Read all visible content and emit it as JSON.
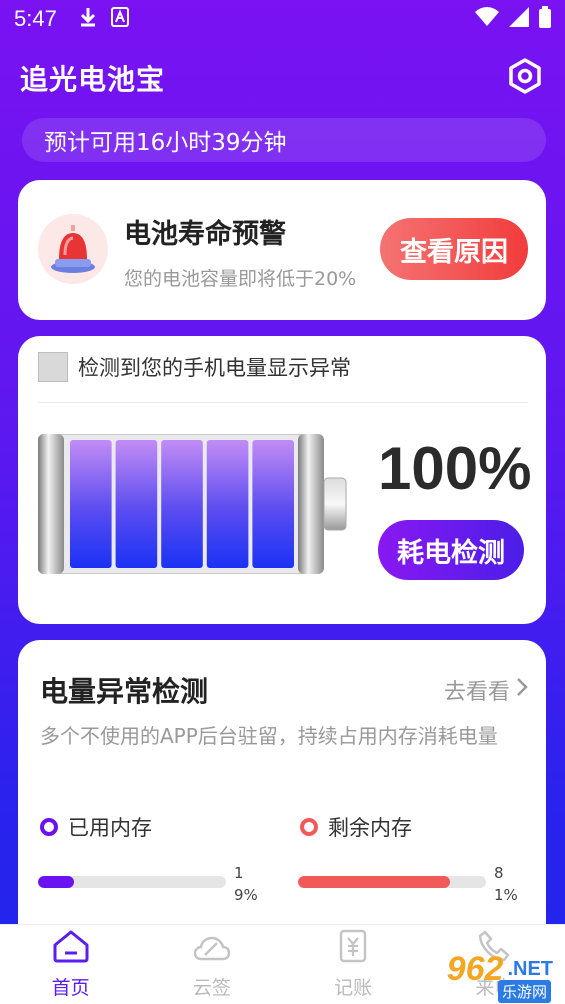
{
  "status_bar": {
    "time": "5:47",
    "icons": [
      "download-icon",
      "a-badge-icon",
      "wifi-icon",
      "signal-icon",
      "battery-icon"
    ]
  },
  "header": {
    "title": "追光电池宝",
    "settings_icon": "gear-hex-icon"
  },
  "estimate": {
    "text": "预计可用16小时39分钟"
  },
  "warning_card": {
    "title": "电池寿命预警",
    "subtitle": "您的电池容量即将低于20%",
    "button_label": "查看原因",
    "icon": "siren-icon"
  },
  "battery_card": {
    "checkbox_label": "检测到您的手机电量显示异常",
    "percent_text": "100%",
    "level": 1.0,
    "cell_count": 5,
    "button_label": "耗电检测"
  },
  "abnormal_card": {
    "title": "电量异常检测",
    "link_label": "去看看",
    "description": "多个不使用的APP后台驻留，持续占用内存消耗电量",
    "used_label": "已用内存",
    "free_label": "剩余内存",
    "used_percent": 19,
    "free_percent": 81,
    "used_pct_text": "19%",
    "free_pct_text": "81%"
  },
  "bottom_nav": {
    "items": [
      {
        "label": "首页",
        "icon": "home-icon",
        "active": true
      },
      {
        "label": "云签",
        "icon": "cloud-sign-icon",
        "active": false
      },
      {
        "label": "记账",
        "icon": "ledger-icon",
        "active": false
      },
      {
        "label": "来电",
        "icon": "phone-icon",
        "active": false
      }
    ]
  },
  "watermark": {
    "number": "962",
    "domain": ".NET",
    "site_name": "乐游网"
  },
  "colors": {
    "primary": "#5a1ef0",
    "used_bar": "#6a12f0",
    "free_bar": "#f25a5a",
    "reason_button": "#f23c3c"
  }
}
